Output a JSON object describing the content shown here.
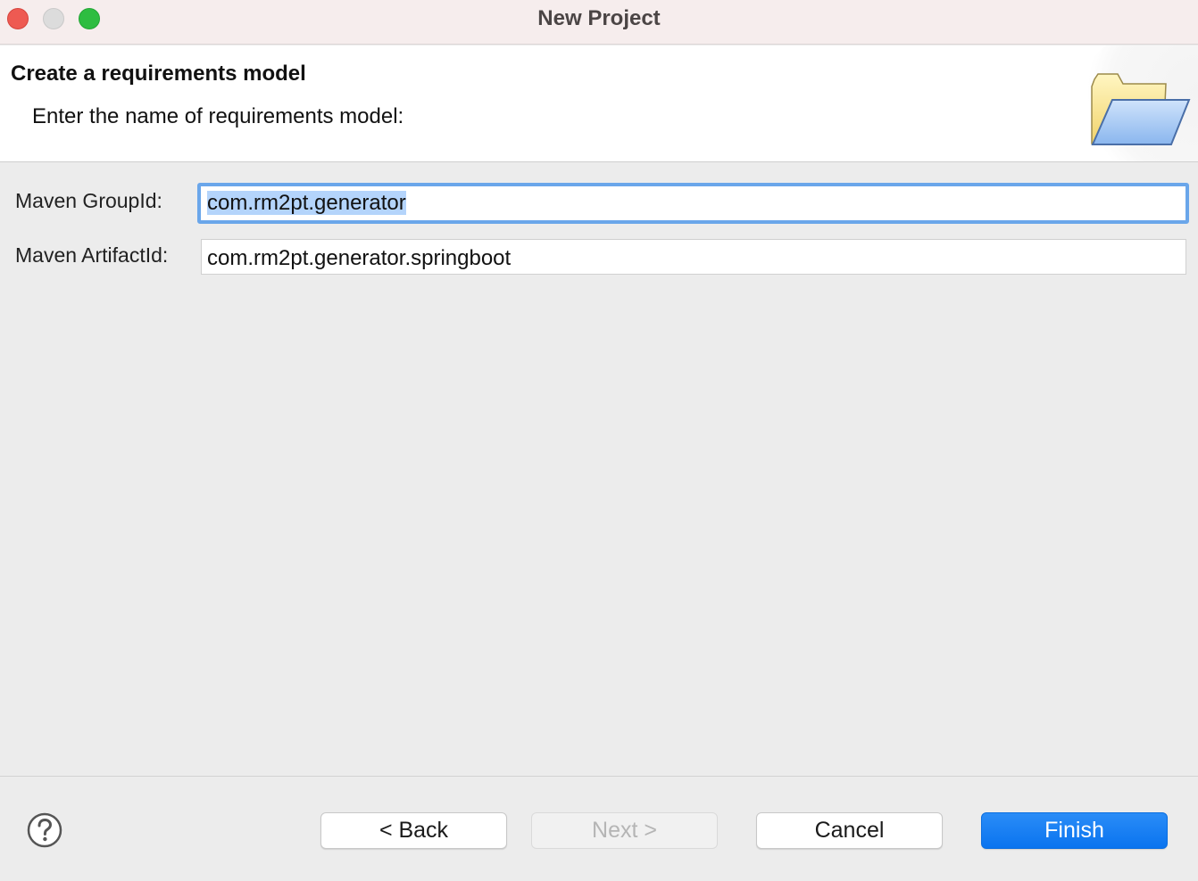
{
  "window": {
    "title": "New Project",
    "traffic_lights": {
      "close_color": "#ee5a52",
      "minimize_color": "#dcdcdc",
      "zoom_color": "#2ebd41"
    }
  },
  "header": {
    "title": "Create a requirements model",
    "description": "Enter the name of requirements model:",
    "icon": "open-folder-icon"
  },
  "form": {
    "group_id": {
      "label": "Maven GroupId:",
      "value": "com.rm2pt.generator",
      "focused": true,
      "text_selected": true
    },
    "artifact_id": {
      "label": "Maven ArtifactId:",
      "value": "com.rm2pt.generator.springboot"
    }
  },
  "footer": {
    "help_icon": "question-mark-icon",
    "back_label": "< Back",
    "next_label": "Next >",
    "cancel_label": "Cancel",
    "finish_label": "Finish",
    "primary_color": "#0a74ef"
  }
}
